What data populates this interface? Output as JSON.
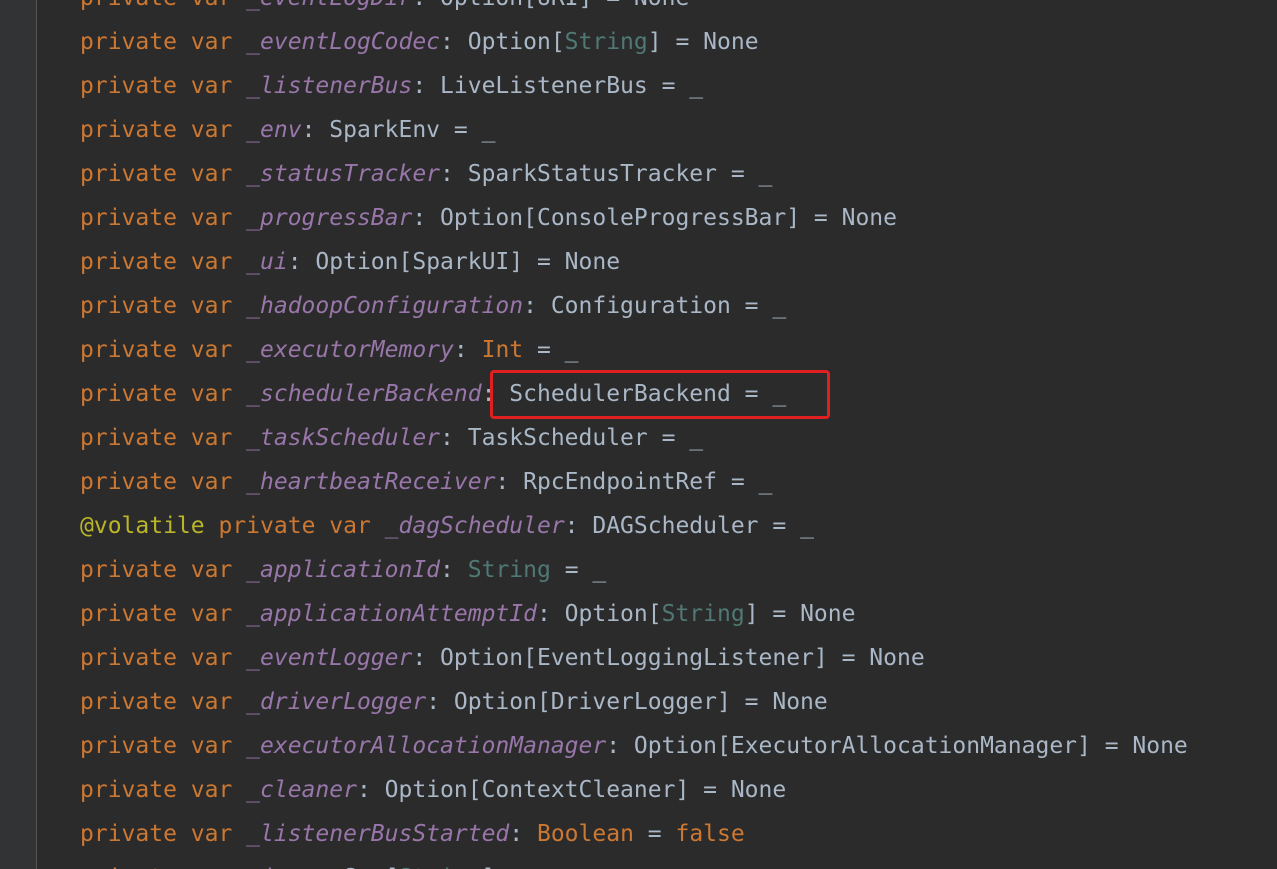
{
  "colors": {
    "background": "#2b2b2b",
    "gutter": "#313335",
    "keyword": "#cc7832",
    "field": "#9876aa",
    "type": "#a9b7c6",
    "string_type": "#507874",
    "annotation": "#bbb529",
    "highlight_box": "#e02020"
  },
  "lines": [
    {
      "name": "line-event-log-dir",
      "tokens": [
        {
          "c": "kw",
          "t": "private var "
        },
        {
          "c": "fld",
          "t": "_eventLogDir"
        },
        {
          "c": "txt",
          "t": ": Option[URI] = None"
        }
      ]
    },
    {
      "name": "line-event-log-codec",
      "tokens": [
        {
          "c": "kw",
          "t": "private var "
        },
        {
          "c": "fld",
          "t": "_eventLogCodec"
        },
        {
          "c": "txt",
          "t": ": Option["
        },
        {
          "c": "str",
          "t": "String"
        },
        {
          "c": "txt",
          "t": "] = None"
        }
      ]
    },
    {
      "name": "line-listener-bus",
      "tokens": [
        {
          "c": "kw",
          "t": "private var "
        },
        {
          "c": "fld",
          "t": "_listenerBus"
        },
        {
          "c": "txt",
          "t": ": LiveListenerBus = _"
        }
      ]
    },
    {
      "name": "line-env",
      "tokens": [
        {
          "c": "kw",
          "t": "private var "
        },
        {
          "c": "fld",
          "t": "_env"
        },
        {
          "c": "txt",
          "t": ": SparkEnv = _"
        }
      ]
    },
    {
      "name": "line-status-tracker",
      "tokens": [
        {
          "c": "kw",
          "t": "private var "
        },
        {
          "c": "fld",
          "t": "_statusTracker"
        },
        {
          "c": "txt",
          "t": ": SparkStatusTracker = _"
        }
      ]
    },
    {
      "name": "line-progress-bar",
      "tokens": [
        {
          "c": "kw",
          "t": "private var "
        },
        {
          "c": "fld",
          "t": "_progressBar"
        },
        {
          "c": "txt",
          "t": ": Option[ConsoleProgressBar] = None"
        }
      ]
    },
    {
      "name": "line-ui",
      "tokens": [
        {
          "c": "kw",
          "t": "private var "
        },
        {
          "c": "fld",
          "t": "_ui"
        },
        {
          "c": "txt",
          "t": ": Option[SparkUI] = None"
        }
      ]
    },
    {
      "name": "line-hadoop-configuration",
      "tokens": [
        {
          "c": "kw",
          "t": "private var "
        },
        {
          "c": "fld",
          "t": "_hadoopConfiguration"
        },
        {
          "c": "txt",
          "t": ": Configuration = _"
        }
      ]
    },
    {
      "name": "line-executor-memory",
      "tokens": [
        {
          "c": "kw",
          "t": "private var "
        },
        {
          "c": "fld",
          "t": "_executorMemory"
        },
        {
          "c": "txt",
          "t": ": "
        },
        {
          "c": "prim",
          "t": "Int"
        },
        {
          "c": "txt",
          "t": " = _"
        }
      ]
    },
    {
      "name": "line-scheduler-backend",
      "tokens": [
        {
          "c": "kw",
          "t": "private var "
        },
        {
          "c": "fld",
          "t": "_schedulerBackend"
        },
        {
          "c": "txt",
          "t": ": SchedulerBackend = _"
        }
      ]
    },
    {
      "name": "line-task-scheduler",
      "tokens": [
        {
          "c": "kw",
          "t": "private var "
        },
        {
          "c": "fld",
          "t": "_taskScheduler"
        },
        {
          "c": "txt",
          "t": ": TaskScheduler = _"
        }
      ]
    },
    {
      "name": "line-heartbeat-receiver",
      "tokens": [
        {
          "c": "kw",
          "t": "private var "
        },
        {
          "c": "fld",
          "t": "_heartbeatReceiver"
        },
        {
          "c": "txt",
          "t": ": RpcEndpointRef = _"
        }
      ]
    },
    {
      "name": "line-dag-scheduler",
      "tokens": [
        {
          "c": "ann",
          "t": "@volatile "
        },
        {
          "c": "kw",
          "t": "private var "
        },
        {
          "c": "fld",
          "t": "_dagScheduler"
        },
        {
          "c": "txt",
          "t": ": DAGScheduler = _"
        }
      ]
    },
    {
      "name": "line-application-id",
      "tokens": [
        {
          "c": "kw",
          "t": "private var "
        },
        {
          "c": "fld",
          "t": "_applicationId"
        },
        {
          "c": "txt",
          "t": ": "
        },
        {
          "c": "str",
          "t": "String"
        },
        {
          "c": "txt",
          "t": " = _"
        }
      ]
    },
    {
      "name": "line-application-attempt-id",
      "tokens": [
        {
          "c": "kw",
          "t": "private var "
        },
        {
          "c": "fld",
          "t": "_applicationAttemptId"
        },
        {
          "c": "txt",
          "t": ": Option["
        },
        {
          "c": "str",
          "t": "String"
        },
        {
          "c": "txt",
          "t": "] = None"
        }
      ]
    },
    {
      "name": "line-event-logger",
      "tokens": [
        {
          "c": "kw",
          "t": "private var "
        },
        {
          "c": "fld",
          "t": "_eventLogger"
        },
        {
          "c": "txt",
          "t": ": Option[EventLoggingListener] = None"
        }
      ]
    },
    {
      "name": "line-driver-logger",
      "tokens": [
        {
          "c": "kw",
          "t": "private var "
        },
        {
          "c": "fld",
          "t": "_driverLogger"
        },
        {
          "c": "txt",
          "t": ": Option[DriverLogger] = None"
        }
      ]
    },
    {
      "name": "line-executor-allocation-manager",
      "tokens": [
        {
          "c": "kw",
          "t": "private var "
        },
        {
          "c": "fld",
          "t": "_executorAllocationManager"
        },
        {
          "c": "txt",
          "t": ": Option[ExecutorAllocationManager] = None"
        }
      ]
    },
    {
      "name": "line-cleaner",
      "tokens": [
        {
          "c": "kw",
          "t": "private var "
        },
        {
          "c": "fld",
          "t": "_cleaner"
        },
        {
          "c": "txt",
          "t": ": Option[ContextCleaner] = None"
        }
      ]
    },
    {
      "name": "line-listener-bus-started",
      "tokens": [
        {
          "c": "kw",
          "t": "private var "
        },
        {
          "c": "fld",
          "t": "_listenerBusStarted"
        },
        {
          "c": "txt",
          "t": ": "
        },
        {
          "c": "prim",
          "t": "Boolean"
        },
        {
          "c": "txt",
          "t": " = "
        },
        {
          "c": "kw",
          "t": "false"
        }
      ]
    },
    {
      "name": "line-partial-bottom",
      "tokens": [
        {
          "c": "kw",
          "t": "private var "
        },
        {
          "c": "fld",
          "t": "_jars"
        },
        {
          "c": "txt",
          "t": ": Seq["
        },
        {
          "c": "str",
          "t": "String"
        },
        {
          "c": "txt",
          "t": "] = _"
        }
      ]
    }
  ],
  "highlight": {
    "line": "line-scheduler-backend",
    "label": "highlighted-region"
  }
}
